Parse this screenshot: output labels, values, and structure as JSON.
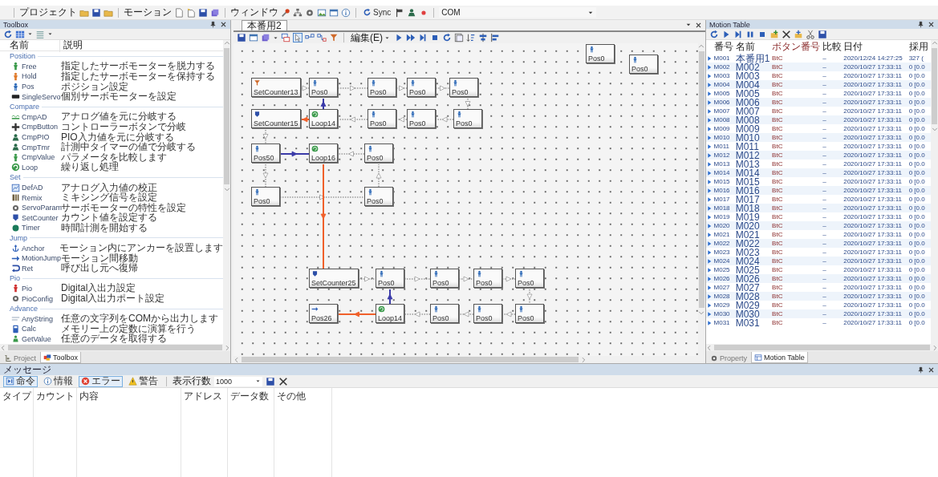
{
  "toolbar": {
    "groups": [
      "プロジェクト",
      "モーション",
      "ウィンドウ"
    ],
    "sync": "Sync",
    "port": "COM"
  },
  "toolbox": {
    "title": "Toolbox",
    "columns": [
      "名前",
      "説明"
    ],
    "sections": [
      {
        "title": "Position",
        "items": [
          {
            "name": "Free",
            "description": "指定したサーボモーターを脱力する"
          },
          {
            "name": "Hold",
            "description": "指定したサーボモーターを保持する"
          },
          {
            "name": "Pos",
            "description": "ポジション設定"
          },
          {
            "name": "SingleServo",
            "description": "個別サーボモーターを設定"
          }
        ]
      },
      {
        "title": "Compare",
        "items": [
          {
            "name": "CmpAD",
            "description": "アナログ値を元に分岐する"
          },
          {
            "name": "CmpButton",
            "description": "コントローラーボタンで分岐"
          },
          {
            "name": "CmpPIO",
            "description": "PIO入力値を元に分岐する"
          },
          {
            "name": "CmpTmr",
            "description": "計測中タイマーの値で分岐する"
          },
          {
            "name": "CmpValue",
            "description": "パラメータを比較します"
          },
          {
            "name": "Loop",
            "description": "繰り返し処理"
          }
        ]
      },
      {
        "title": "Set",
        "items": [
          {
            "name": "DefAD",
            "description": "アナログ入力値の校正"
          },
          {
            "name": "Remix",
            "description": "ミキシング信号を設定"
          },
          {
            "name": "ServoParam",
            "description": "サーボモーターの特性を設定"
          },
          {
            "name": "SetCounter",
            "description": "カウント値を設定する"
          },
          {
            "name": "Timer",
            "description": "時間計測を開始する"
          }
        ]
      },
      {
        "title": "Jump",
        "items": [
          {
            "name": "Anchor",
            "description": "モーション内にアンカーを設置します"
          },
          {
            "name": "MotionJump",
            "description": "モーション間移動"
          },
          {
            "name": "Ret",
            "description": "呼び出し元へ復帰"
          }
        ]
      },
      {
        "title": "Pio",
        "items": [
          {
            "name": "Pio",
            "description": "Digital入出力設定"
          },
          {
            "name": "PioConfig",
            "description": "Digital入出力ポート設定"
          }
        ]
      },
      {
        "title": "Advance",
        "items": [
          {
            "name": "AnyString",
            "description": "任意の文字列をCOMから出力します"
          },
          {
            "name": "Calc",
            "description": "メモリー上の定数に演算を行う"
          },
          {
            "name": "GetValue",
            "description": "任意のデータを取得する"
          }
        ]
      }
    ],
    "tabs": [
      {
        "label": "Project",
        "selected": false
      },
      {
        "label": "Toolbox",
        "selected": true
      }
    ]
  },
  "editor": {
    "tabs": [
      {
        "label": "本番用2",
        "selected": true
      }
    ],
    "menu": "編集(E)",
    "nodes": [
      {
        "kind": "flag",
        "label": "SetCounter13"
      },
      {
        "kind": "pos",
        "label": "Pos0"
      },
      {
        "kind": "pos",
        "label": "Pos0"
      },
      {
        "kind": "pos",
        "label": "Pos0"
      },
      {
        "kind": "pos",
        "label": "Pos0"
      },
      {
        "kind": "counter",
        "label": "SetCounter15"
      },
      {
        "kind": "loop",
        "label": "Loop14"
      },
      {
        "kind": "pos",
        "label": "Pos0"
      },
      {
        "kind": "pos",
        "label": "Pos0"
      },
      {
        "kind": "pos",
        "label": "Pos0"
      },
      {
        "kind": "pos",
        "label": "Pos50"
      },
      {
        "kind": "loop",
        "label": "Loop16"
      },
      {
        "kind": "pos",
        "label": "Pos0"
      },
      {
        "kind": "pos",
        "label": "Pos0"
      },
      {
        "kind": "pos",
        "label": "Pos0"
      },
      {
        "kind": "counter",
        "label": "SetCounter25"
      },
      {
        "kind": "pos",
        "label": "Pos0"
      },
      {
        "kind": "pos",
        "label": "Pos0"
      },
      {
        "kind": "pos",
        "label": "Pos0"
      },
      {
        "kind": "pos",
        "label": "Pos0"
      },
      {
        "kind": "jump",
        "label": "Pos26"
      },
      {
        "kind": "loop",
        "label": "Loop14"
      },
      {
        "kind": "pos",
        "label": "Pos0"
      },
      {
        "kind": "pos",
        "label": "Pos0"
      },
      {
        "kind": "pos",
        "label": "Pos0"
      },
      {
        "kind": "pos",
        "label": "Pos0"
      },
      {
        "kind": "pos",
        "label": "Pos0"
      }
    ]
  },
  "motion_table": {
    "title": "Motion Table",
    "columns": [
      "番号",
      "名前",
      "ボタン番号",
      "比較",
      "日付",
      "採用"
    ],
    "rows": [
      {
        "no": "M001",
        "name": "本番用1",
        "button": "BtC",
        "compare": "–",
        "date": "2020/12/24 14:27:25",
        "column_6": "327 ("
      },
      {
        "no": "M002",
        "name": "M002",
        "button": "BtC",
        "compare": "–",
        "date": "2020/10/27 17:33:11",
        "column_6": "0 [0.0"
      },
      {
        "no": "M003",
        "name": "M003",
        "button": "BtC",
        "compare": "–",
        "date": "2020/10/27 17:33:11",
        "column_6": "0 [0.0"
      },
      {
        "no": "M004",
        "name": "M004",
        "button": "BtC",
        "compare": "–",
        "date": "2020/10/27 17:33:11",
        "column_6": "0 [0.0"
      },
      {
        "no": "M005",
        "name": "M005",
        "button": "BtC",
        "compare": "–",
        "date": "2020/10/27 17:33:11",
        "column_6": "0 [0.0"
      },
      {
        "no": "M006",
        "name": "M006",
        "button": "BtC",
        "compare": "–",
        "date": "2020/10/27 17:33:11",
        "column_6": "0 [0.0"
      },
      {
        "no": "M007",
        "name": "M007",
        "button": "BtC",
        "compare": "–",
        "date": "2020/10/27 17:33:11",
        "column_6": "0 [0.0"
      },
      {
        "no": "M008",
        "name": "M008",
        "button": "BtC",
        "compare": "–",
        "date": "2020/10/27 17:33:11",
        "column_6": "0 [0.0"
      },
      {
        "no": "M009",
        "name": "M009",
        "button": "BtC",
        "compare": "–",
        "date": "2020/10/27 17:33:11",
        "column_6": "0 [0.0"
      },
      {
        "no": "M010",
        "name": "M010",
        "button": "BtC",
        "compare": "–",
        "date": "2020/10/27 17:33:11",
        "column_6": "0 [0.0"
      },
      {
        "no": "M011",
        "name": "M011",
        "button": "BtC",
        "compare": "–",
        "date": "2020/10/27 17:33:11",
        "column_6": "0 [0.0"
      },
      {
        "no": "M012",
        "name": "M012",
        "button": "BtC",
        "compare": "–",
        "date": "2020/10/27 17:33:11",
        "column_6": "0 [0.0"
      },
      {
        "no": "M013",
        "name": "M013",
        "button": "BtC",
        "compare": "–",
        "date": "2020/10/27 17:33:11",
        "column_6": "0 [0.0"
      },
      {
        "no": "M014",
        "name": "M014",
        "button": "BtC",
        "compare": "–",
        "date": "2020/10/27 17:33:11",
        "column_6": "0 [0.0"
      },
      {
        "no": "M015",
        "name": "M015",
        "button": "BtC",
        "compare": "–",
        "date": "2020/10/27 17:33:11",
        "column_6": "0 [0.0"
      },
      {
        "no": "M016",
        "name": "M016",
        "button": "BtC",
        "compare": "–",
        "date": "2020/10/27 17:33:11",
        "column_6": "0 [0.0"
      },
      {
        "no": "M017",
        "name": "M017",
        "button": "BtC",
        "compare": "–",
        "date": "2020/10/27 17:33:11",
        "column_6": "0 [0.0"
      },
      {
        "no": "M018",
        "name": "M018",
        "button": "BtC",
        "compare": "–",
        "date": "2020/10/27 17:33:11",
        "column_6": "0 [0.0"
      },
      {
        "no": "M019",
        "name": "M019",
        "button": "BtC",
        "compare": "–",
        "date": "2020/10/27 17:33:11",
        "column_6": "0 [0.0"
      },
      {
        "no": "M020",
        "name": "M020",
        "button": "BtC",
        "compare": "–",
        "date": "2020/10/27 17:33:11",
        "column_6": "0 [0.0"
      },
      {
        "no": "M021",
        "name": "M021",
        "button": "BtC",
        "compare": "–",
        "date": "2020/10/27 17:33:11",
        "column_6": "0 [0.0"
      },
      {
        "no": "M022",
        "name": "M022",
        "button": "BtC",
        "compare": "–",
        "date": "2020/10/27 17:33:11",
        "column_6": "0 [0.0"
      },
      {
        "no": "M023",
        "name": "M023",
        "button": "BtC",
        "compare": "–",
        "date": "2020/10/27 17:33:11",
        "column_6": "0 [0.0"
      },
      {
        "no": "M024",
        "name": "M024",
        "button": "BtC",
        "compare": "–",
        "date": "2020/10/27 17:33:11",
        "column_6": "0 [0.0"
      },
      {
        "no": "M025",
        "name": "M025",
        "button": "BtC",
        "compare": "–",
        "date": "2020/10/27 17:33:11",
        "column_6": "0 [0.0"
      },
      {
        "no": "M026",
        "name": "M026",
        "button": "BtC",
        "compare": "–",
        "date": "2020/10/27 17:33:11",
        "column_6": "0 [0.0"
      },
      {
        "no": "M027",
        "name": "M027",
        "button": "BtC",
        "compare": "–",
        "date": "2020/10/27 17:33:11",
        "column_6": "0 [0.0"
      },
      {
        "no": "M028",
        "name": "M028",
        "button": "BtC",
        "compare": "–",
        "date": "2020/10/27 17:33:11",
        "column_6": "0 [0.0"
      },
      {
        "no": "M029",
        "name": "M029",
        "button": "BtC",
        "compare": "–",
        "date": "2020/10/27 17:33:11",
        "column_6": "0 [0.0"
      },
      {
        "no": "M030",
        "name": "M030",
        "button": "BtC",
        "compare": "–",
        "date": "2020/10/27 17:33:11",
        "column_6": "0 [0.0"
      },
      {
        "no": "M031",
        "name": "M031",
        "button": "BtC",
        "compare": "–",
        "date": "2020/10/27 17:33:11",
        "column_6": "0 [0.0"
      }
    ],
    "tabs": [
      {
        "label": "Property",
        "selected": false
      },
      {
        "label": "Motion Table",
        "selected": true
      }
    ]
  },
  "messages": {
    "title": "メッセージ",
    "filters": [
      {
        "label": "命令",
        "selected": true
      },
      {
        "label": "情報",
        "selected": false
      },
      {
        "label": "エラー",
        "selected": true
      },
      {
        "label": "警告",
        "selected": false
      }
    ],
    "rows_label": "表示行数",
    "rows_value": "1000",
    "columns": [
      "タイプ",
      "カウント",
      "内容",
      "アドレス",
      "データ数",
      "その他"
    ]
  }
}
